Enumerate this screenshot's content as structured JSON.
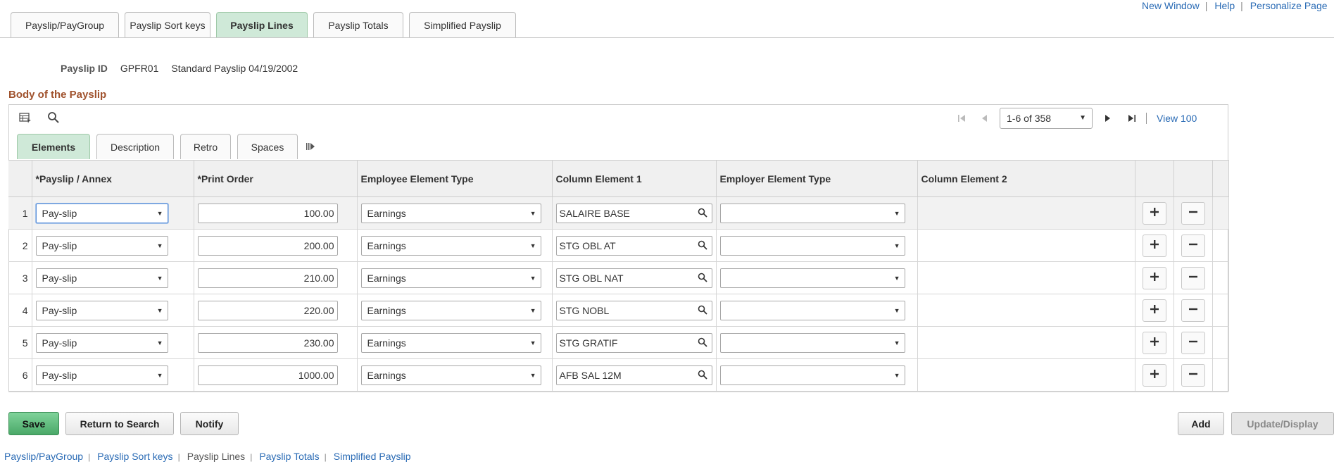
{
  "top_links": {
    "new_window": "New Window",
    "help": "Help",
    "personalize": "Personalize Page"
  },
  "page_tabs": [
    {
      "label": "Payslip/PayGroup",
      "active": false
    },
    {
      "label": "Payslip Sort keys",
      "active": false
    },
    {
      "label": "Payslip Lines",
      "active": true
    },
    {
      "label": "Payslip Totals",
      "active": false
    },
    {
      "label": "Simplified Payslip",
      "active": false
    }
  ],
  "payslip": {
    "id_label": "Payslip ID",
    "id": "GPFR01",
    "description": "Standard Payslip 04/19/2002"
  },
  "section_title": "Body of the Payslip",
  "toolbar": {
    "grid_icon": "personalize-grid-icon",
    "find_icon": "find-icon"
  },
  "pager": {
    "range": "1-6 of 358",
    "view_all": "View 100"
  },
  "sub_tabs": [
    {
      "label": "Elements",
      "active": true
    },
    {
      "label": "Description",
      "active": false
    },
    {
      "label": "Retro",
      "active": false
    },
    {
      "label": "Spaces",
      "active": false
    }
  ],
  "columns": [
    "*Payslip / Annex",
    "*Print Order",
    "Employee Element Type",
    "Column Element 1",
    "Employer Element Type",
    "Column Element 2"
  ],
  "rows": [
    {
      "num": "1",
      "annex": "Pay-slip",
      "order": "100.00",
      "ee_type": "Earnings",
      "col1": "SALAIRE BASE",
      "er_type": ""
    },
    {
      "num": "2",
      "annex": "Pay-slip",
      "order": "200.00",
      "ee_type": "Earnings",
      "col1": "STG OBL AT",
      "er_type": ""
    },
    {
      "num": "3",
      "annex": "Pay-slip",
      "order": "210.00",
      "ee_type": "Earnings",
      "col1": "STG OBL NAT",
      "er_type": ""
    },
    {
      "num": "4",
      "annex": "Pay-slip",
      "order": "220.00",
      "ee_type": "Earnings",
      "col1": "STG NOBL",
      "er_type": ""
    },
    {
      "num": "5",
      "annex": "Pay-slip",
      "order": "230.00",
      "ee_type": "Earnings",
      "col1": "STG GRATIF",
      "er_type": ""
    },
    {
      "num": "6",
      "annex": "Pay-slip",
      "order": "1000.00",
      "ee_type": "Earnings",
      "col1": "AFB SAL 12M",
      "er_type": ""
    }
  ],
  "buttons": {
    "save": "Save",
    "return": "Return to Search",
    "notify": "Notify",
    "add": "Add",
    "update": "Update/Display"
  },
  "footer_links": [
    {
      "label": "Payslip/PayGroup",
      "current": false
    },
    {
      "label": "Payslip Sort keys",
      "current": false
    },
    {
      "label": "Payslip Lines",
      "current": true
    },
    {
      "label": "Payslip Totals",
      "current": false
    },
    {
      "label": "Simplified Payslip",
      "current": false
    }
  ],
  "colors": {
    "active_tab": "#cfe9d8",
    "save_button": "#4aa868",
    "section_title": "#a0522d",
    "link": "#2a6bb5"
  }
}
